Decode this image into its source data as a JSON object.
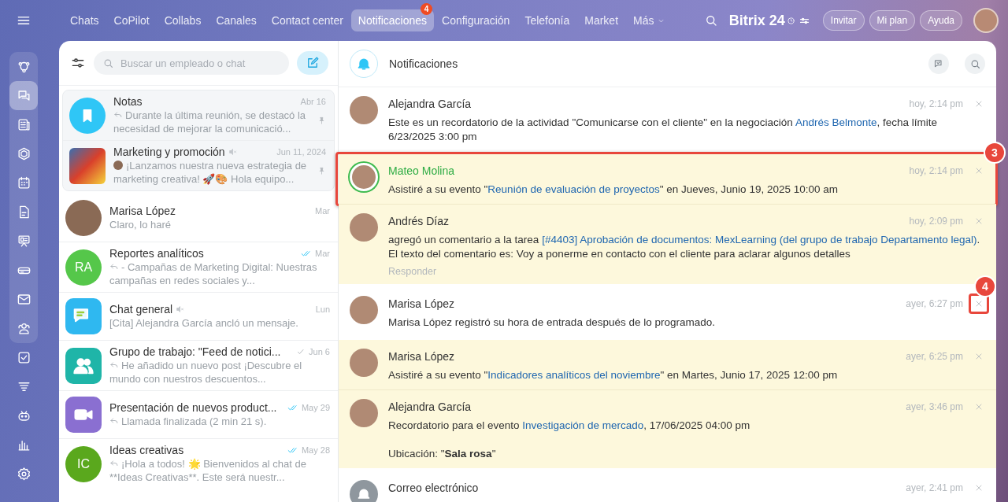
{
  "top_nav": {
    "items": [
      {
        "label": "Chats",
        "selected": false,
        "dropdown": false
      },
      {
        "label": "CoPilot",
        "selected": false,
        "dropdown": false
      },
      {
        "label": "Collabs",
        "selected": false,
        "dropdown": false
      },
      {
        "label": "Canales",
        "selected": false,
        "dropdown": false
      },
      {
        "label": "Contact center",
        "selected": false,
        "dropdown": false
      },
      {
        "label": "Notificaciones",
        "selected": true,
        "dropdown": false,
        "badge": "4"
      },
      {
        "label": "Configuración",
        "selected": false,
        "dropdown": false
      },
      {
        "label": "Telefonía",
        "selected": false,
        "dropdown": false
      },
      {
        "label": "Market",
        "selected": false,
        "dropdown": false
      },
      {
        "label": "Más",
        "selected": false,
        "dropdown": true
      }
    ],
    "brand": "Bitrix 24",
    "buttons": [
      "Invitar",
      "Mi plan",
      "Ayuda"
    ]
  },
  "sidebar": {
    "items": [
      {
        "selected": false
      },
      {
        "selected": true
      },
      {
        "selected": false
      },
      {
        "selected": false
      },
      {
        "selected": false
      },
      {
        "selected": false
      },
      {
        "selected": false
      },
      {
        "selected": false
      },
      {
        "selected": false
      },
      {
        "selected": false
      },
      {
        "selected": false
      },
      {
        "selected": false
      },
      {
        "selected": false
      },
      {
        "selected": false
      },
      {
        "selected": false
      }
    ]
  },
  "chat_list": {
    "search": {
      "placeholder": "Buscar un empleado o chat"
    },
    "items": [
      {
        "title": "Notas",
        "date": "Abr 16",
        "preview": "Durante la última reunión, se destacó la necesidad de mejorar la comunicació...",
        "reply": true,
        "sender_avatar": false,
        "pinned": true,
        "muted": false,
        "sent": false,
        "read": false,
        "avatar": {
          "kind": "bookmark"
        }
      },
      {
        "title": "Marketing y promoción",
        "date": "Jun 11, 2024",
        "preview": "¡Lanzamos nuestra nueva estrategia de marketing creativa! 🚀🎨 Hola equipo...",
        "reply": false,
        "sender_avatar": true,
        "pinned": true,
        "muted": true,
        "sent": false,
        "read": false,
        "avatar": {
          "kind": "photo"
        }
      },
      {
        "title": "Marisa López",
        "date": "Mar",
        "preview": "Claro, lo haré",
        "reply": false,
        "sender_avatar": false,
        "pinned": false,
        "muted": false,
        "sent": false,
        "read": false,
        "avatar": {
          "kind": "person"
        }
      },
      {
        "title": "Reportes analíticos",
        "date": "Mar",
        "preview": "- Campañas de Marketing Digital: Nuestras campañas en redes sociales y...",
        "reply": true,
        "sender_avatar": false,
        "pinned": false,
        "muted": false,
        "sent": true,
        "read": true,
        "avatar": {
          "kind": "initials",
          "text": "RA",
          "color": "#55c74a"
        }
      },
      {
        "title": "Chat general",
        "date": "Lun",
        "preview": "[Cita] Alejandra García ancló un mensaje.",
        "reply": false,
        "sender_avatar": false,
        "pinned": false,
        "muted": true,
        "sent": false,
        "read": false,
        "avatar": {
          "kind": "chat"
        }
      },
      {
        "title": "Grupo de trabajo: \"Feed de notici...",
        "date": "Jun 6",
        "preview": "He añadido un nuevo post ¡Descubre el mundo con nuestros descuentos...",
        "reply": true,
        "sender_avatar": false,
        "pinned": false,
        "muted": false,
        "sent": true,
        "read": false,
        "avatar": {
          "kind": "group"
        }
      },
      {
        "title": "Presentación de nuevos product...",
        "date": "May 29",
        "preview": "Llamada finalizada (2 min 21 s).",
        "reply": true,
        "sender_avatar": false,
        "pinned": false,
        "muted": false,
        "sent": true,
        "read": true,
        "avatar": {
          "kind": "video"
        }
      },
      {
        "title": "Ideas creativas",
        "date": "May 28",
        "preview": "¡Hola a todos! 🌟 Bienvenidos al chat de **Ideas Creativas**. Este será nuestr...",
        "reply": true,
        "sender_avatar": false,
        "pinned": false,
        "muted": false,
        "sent": true,
        "read": true,
        "avatar": {
          "kind": "initials",
          "text": "IC",
          "color": "#5aa81d"
        }
      }
    ]
  },
  "notifications": {
    "title": "Notificaciones",
    "items": [
      {
        "name": "Alejandra García",
        "time": "hoy, 2:14 pm",
        "unread": false,
        "active": false,
        "avatar": {
          "kind": "photo"
        },
        "body": [
          [
            {
              "kind": "text",
              "text": "Este es un recordatorio de la actividad \"Comunicarse con el cliente\" en la negociación "
            },
            {
              "kind": "link",
              "text": "Andrés Belmonte"
            },
            {
              "kind": "text",
              "text": ", fecha límite 6/23/2025 3:00 pm"
            }
          ]
        ]
      },
      {
        "name": "Mateo Molina",
        "time": "hoy, 2:14 pm",
        "unread": true,
        "active": true,
        "avatar": {
          "kind": "photo"
        },
        "callout": "3",
        "body": [
          [
            {
              "kind": "text",
              "text": "Asistiré a su evento \""
            },
            {
              "kind": "link",
              "text": "Reunión de evaluación de proyectos"
            },
            {
              "kind": "text",
              "text": "\" en Jueves, Junio 19, 2025 10:00 am"
            }
          ]
        ]
      },
      {
        "name": "Andrés Díaz",
        "time": "hoy, 2:09 pm",
        "unread": true,
        "active": false,
        "avatar": {
          "kind": "photo"
        },
        "action": "Responder",
        "body": [
          [
            {
              "kind": "text",
              "text": "agregó un comentario a la tarea "
            },
            {
              "kind": "link",
              "text": "[#4403] Aprobación de documentos: MexLearning (del grupo de trabajo Departamento legal)"
            },
            {
              "kind": "text",
              "text": ". El texto del comentario es: Voy a ponerme en contacto con el cliente para aclarar algunos detalles"
            }
          ]
        ]
      },
      {
        "name": "Marisa López",
        "time": "ayer, 6:27 pm",
        "unread": false,
        "active": false,
        "avatar": {
          "kind": "photo"
        },
        "close_callout": "4",
        "body": [
          [
            {
              "kind": "text",
              "text": "Marisa López registró su hora de entrada después de lo programado."
            }
          ]
        ]
      },
      {
        "name": "Marisa López",
        "time": "ayer, 6:25 pm",
        "unread": true,
        "active": false,
        "avatar": {
          "kind": "photo"
        },
        "body": [
          [
            {
              "kind": "text",
              "text": "Asistiré a su evento \""
            },
            {
              "kind": "link",
              "text": "Indicadores analíticos del noviembre"
            },
            {
              "kind": "text",
              "text": "\" en Martes, Junio 17, 2025 12:00 pm"
            }
          ]
        ]
      },
      {
        "name": "Alejandra García",
        "time": "ayer, 3:46 pm",
        "unread": true,
        "active": false,
        "avatar": {
          "kind": "photo"
        },
        "body": [
          [
            {
              "kind": "text",
              "text": "Recordatorio para el evento "
            },
            {
              "kind": "link",
              "text": "Investigación de mercado"
            },
            {
              "kind": "text",
              "text": ", 17/06/2025 04:00 pm"
            }
          ],
          [
            {
              "kind": "text",
              "text": "Ubicación: \""
            },
            {
              "kind": "bold",
              "text": "Sala rosa"
            },
            {
              "kind": "text",
              "text": "\""
            }
          ]
        ]
      },
      {
        "name": "Correo electrónico",
        "time": "ayer, 2:41 pm",
        "unread": false,
        "active": false,
        "avatar": {
          "kind": "bell"
        }
      }
    ]
  }
}
